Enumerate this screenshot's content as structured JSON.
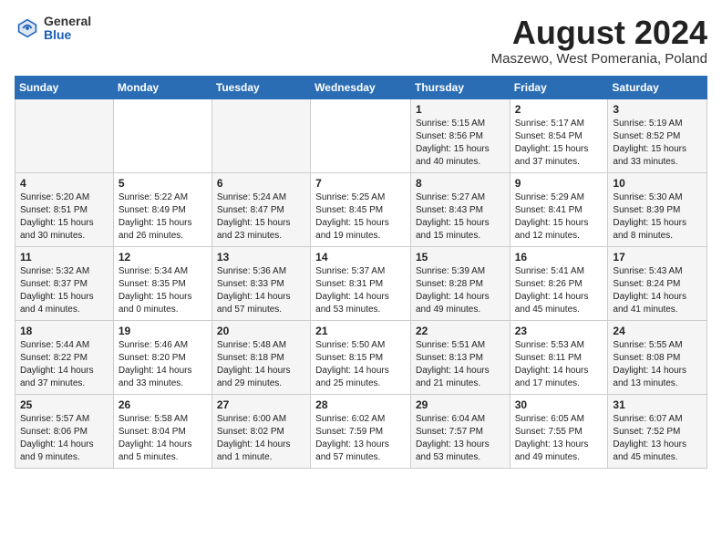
{
  "header": {
    "logo_general": "General",
    "logo_blue": "Blue",
    "month_title": "August 2024",
    "location": "Maszewo, West Pomerania, Poland"
  },
  "days_of_week": [
    "Sunday",
    "Monday",
    "Tuesday",
    "Wednesday",
    "Thursday",
    "Friday",
    "Saturday"
  ],
  "weeks": [
    [
      {
        "num": "",
        "info": ""
      },
      {
        "num": "",
        "info": ""
      },
      {
        "num": "",
        "info": ""
      },
      {
        "num": "",
        "info": ""
      },
      {
        "num": "1",
        "info": "Sunrise: 5:15 AM\nSunset: 8:56 PM\nDaylight: 15 hours\nand 40 minutes."
      },
      {
        "num": "2",
        "info": "Sunrise: 5:17 AM\nSunset: 8:54 PM\nDaylight: 15 hours\nand 37 minutes."
      },
      {
        "num": "3",
        "info": "Sunrise: 5:19 AM\nSunset: 8:52 PM\nDaylight: 15 hours\nand 33 minutes."
      }
    ],
    [
      {
        "num": "4",
        "info": "Sunrise: 5:20 AM\nSunset: 8:51 PM\nDaylight: 15 hours\nand 30 minutes."
      },
      {
        "num": "5",
        "info": "Sunrise: 5:22 AM\nSunset: 8:49 PM\nDaylight: 15 hours\nand 26 minutes."
      },
      {
        "num": "6",
        "info": "Sunrise: 5:24 AM\nSunset: 8:47 PM\nDaylight: 15 hours\nand 23 minutes."
      },
      {
        "num": "7",
        "info": "Sunrise: 5:25 AM\nSunset: 8:45 PM\nDaylight: 15 hours\nand 19 minutes."
      },
      {
        "num": "8",
        "info": "Sunrise: 5:27 AM\nSunset: 8:43 PM\nDaylight: 15 hours\nand 15 minutes."
      },
      {
        "num": "9",
        "info": "Sunrise: 5:29 AM\nSunset: 8:41 PM\nDaylight: 15 hours\nand 12 minutes."
      },
      {
        "num": "10",
        "info": "Sunrise: 5:30 AM\nSunset: 8:39 PM\nDaylight: 15 hours\nand 8 minutes."
      }
    ],
    [
      {
        "num": "11",
        "info": "Sunrise: 5:32 AM\nSunset: 8:37 PM\nDaylight: 15 hours\nand 4 minutes."
      },
      {
        "num": "12",
        "info": "Sunrise: 5:34 AM\nSunset: 8:35 PM\nDaylight: 15 hours\nand 0 minutes."
      },
      {
        "num": "13",
        "info": "Sunrise: 5:36 AM\nSunset: 8:33 PM\nDaylight: 14 hours\nand 57 minutes."
      },
      {
        "num": "14",
        "info": "Sunrise: 5:37 AM\nSunset: 8:31 PM\nDaylight: 14 hours\nand 53 minutes."
      },
      {
        "num": "15",
        "info": "Sunrise: 5:39 AM\nSunset: 8:28 PM\nDaylight: 14 hours\nand 49 minutes."
      },
      {
        "num": "16",
        "info": "Sunrise: 5:41 AM\nSunset: 8:26 PM\nDaylight: 14 hours\nand 45 minutes."
      },
      {
        "num": "17",
        "info": "Sunrise: 5:43 AM\nSunset: 8:24 PM\nDaylight: 14 hours\nand 41 minutes."
      }
    ],
    [
      {
        "num": "18",
        "info": "Sunrise: 5:44 AM\nSunset: 8:22 PM\nDaylight: 14 hours\nand 37 minutes."
      },
      {
        "num": "19",
        "info": "Sunrise: 5:46 AM\nSunset: 8:20 PM\nDaylight: 14 hours\nand 33 minutes."
      },
      {
        "num": "20",
        "info": "Sunrise: 5:48 AM\nSunset: 8:18 PM\nDaylight: 14 hours\nand 29 minutes."
      },
      {
        "num": "21",
        "info": "Sunrise: 5:50 AM\nSunset: 8:15 PM\nDaylight: 14 hours\nand 25 minutes."
      },
      {
        "num": "22",
        "info": "Sunrise: 5:51 AM\nSunset: 8:13 PM\nDaylight: 14 hours\nand 21 minutes."
      },
      {
        "num": "23",
        "info": "Sunrise: 5:53 AM\nSunset: 8:11 PM\nDaylight: 14 hours\nand 17 minutes."
      },
      {
        "num": "24",
        "info": "Sunrise: 5:55 AM\nSunset: 8:08 PM\nDaylight: 14 hours\nand 13 minutes."
      }
    ],
    [
      {
        "num": "25",
        "info": "Sunrise: 5:57 AM\nSunset: 8:06 PM\nDaylight: 14 hours\nand 9 minutes."
      },
      {
        "num": "26",
        "info": "Sunrise: 5:58 AM\nSunset: 8:04 PM\nDaylight: 14 hours\nand 5 minutes."
      },
      {
        "num": "27",
        "info": "Sunrise: 6:00 AM\nSunset: 8:02 PM\nDaylight: 14 hours\nand 1 minute."
      },
      {
        "num": "28",
        "info": "Sunrise: 6:02 AM\nSunset: 7:59 PM\nDaylight: 13 hours\nand 57 minutes."
      },
      {
        "num": "29",
        "info": "Sunrise: 6:04 AM\nSunset: 7:57 PM\nDaylight: 13 hours\nand 53 minutes."
      },
      {
        "num": "30",
        "info": "Sunrise: 6:05 AM\nSunset: 7:55 PM\nDaylight: 13 hours\nand 49 minutes."
      },
      {
        "num": "31",
        "info": "Sunrise: 6:07 AM\nSunset: 7:52 PM\nDaylight: 13 hours\nand 45 minutes."
      }
    ]
  ]
}
